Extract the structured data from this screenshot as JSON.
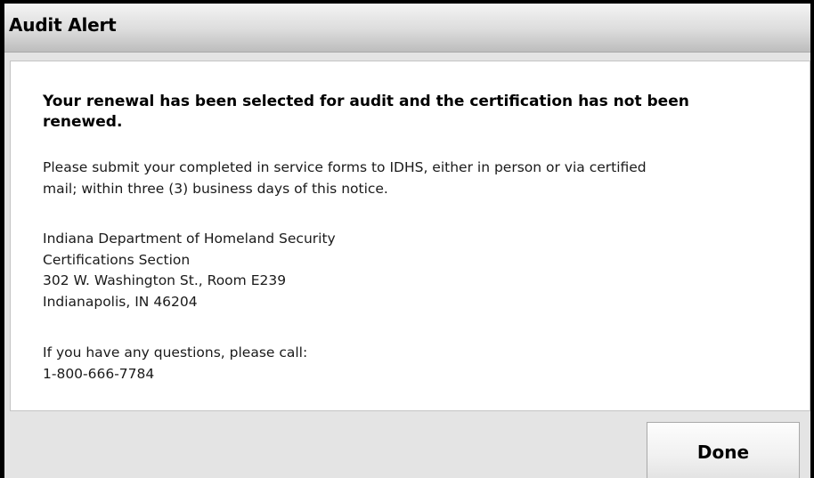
{
  "dialog": {
    "title": "Audit Alert"
  },
  "message": {
    "heading": "Your renewal has been selected for audit and the certification has not been renewed.",
    "notice_lines": [
      "Please submit your completed in service forms to IDHS, either in person or via certified",
      "mail; within three (3) business days of this notice."
    ],
    "address_lines": [
      "Indiana Department of Homeland Security",
      "Certifications Section",
      "302 W. Washington St., Room E239",
      "Indianapolis, IN 46204"
    ],
    "contact_lines": [
      "If you have any questions, please call:",
      "1-800-666-7784"
    ]
  },
  "footer": {
    "done_label": "Done"
  }
}
